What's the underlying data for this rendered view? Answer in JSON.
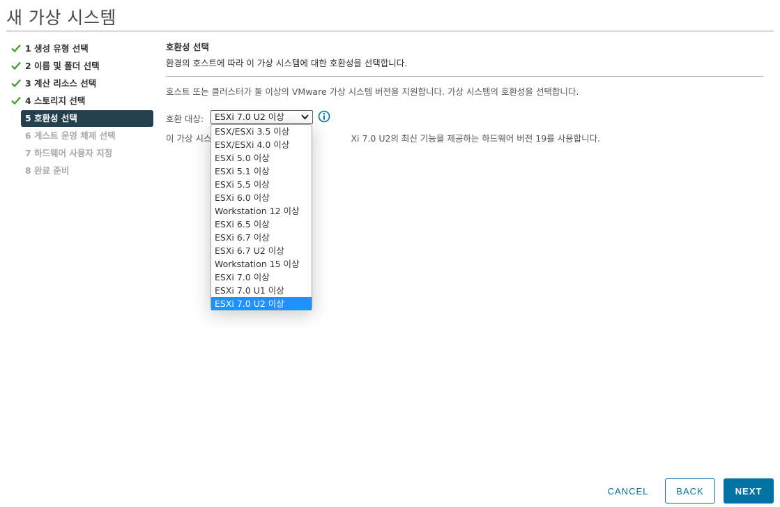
{
  "window": {
    "title": "새 가상 시스템"
  },
  "steps": [
    {
      "label": "1 생성 유형 선택",
      "state": "done"
    },
    {
      "label": "2 이름 및 폴더 선택",
      "state": "done"
    },
    {
      "label": "3 계산 리소스 선택",
      "state": "done"
    },
    {
      "label": "4 스토리지 선택",
      "state": "done"
    },
    {
      "label": "5 호환성 선택",
      "state": "active"
    },
    {
      "label": "6 게스트 운영 체제 선택",
      "state": "pending"
    },
    {
      "label": "7 하드웨어 사용자 지정",
      "state": "pending"
    },
    {
      "label": "8 완료 준비",
      "state": "pending"
    }
  ],
  "main": {
    "section_title": "호환성 선택",
    "section_subtitle": "환경의 호스트에 따라 이 가상 시스템에 대한 호환성을 선택합니다.",
    "description": "호스트 또는 클러스터가 둘 이상의 VMware 가상 시스템 버전을 지원합니다. 가상 시스템의 호환성을 선택합니다.",
    "compat_label": "호환 대상:",
    "selected_value": "ESXi 7.0 U2 이상",
    "note_left": "이 가상 시스",
    "note_right": "Xi 7.0 U2의 최신 기능을 제공하는 하드웨어 버전 19를 사용합니다."
  },
  "dropdown": {
    "options": [
      "ESX/ESXi 3.5 이상",
      "ESX/ESXi 4.0 이상",
      "ESXi 5.0 이상",
      "ESXi 5.1 이상",
      "ESXi 5.5 이상",
      "ESXi 6.0 이상",
      "Workstation 12 이상",
      "ESXi 6.5 이상",
      "ESXi 6.7 이상",
      "ESXi 6.7 U2 이상",
      "Workstation 15 이상",
      "ESXi 7.0 이상",
      "ESXi 7.0 U1 이상",
      "ESXi 7.0 U2 이상"
    ],
    "selected_index": 13
  },
  "footer": {
    "cancel_label": "CANCEL",
    "back_label": "BACK",
    "next_label": "NEXT"
  },
  "colors": {
    "accent": "#0072a3",
    "active_step_bg": "#24404f",
    "check_green": "#3c9a2a",
    "selected_option": "#1e90ff"
  },
  "icons": {
    "step_done": "check-icon",
    "info": "info-icon",
    "select_caret": "chevron-down-icon"
  }
}
